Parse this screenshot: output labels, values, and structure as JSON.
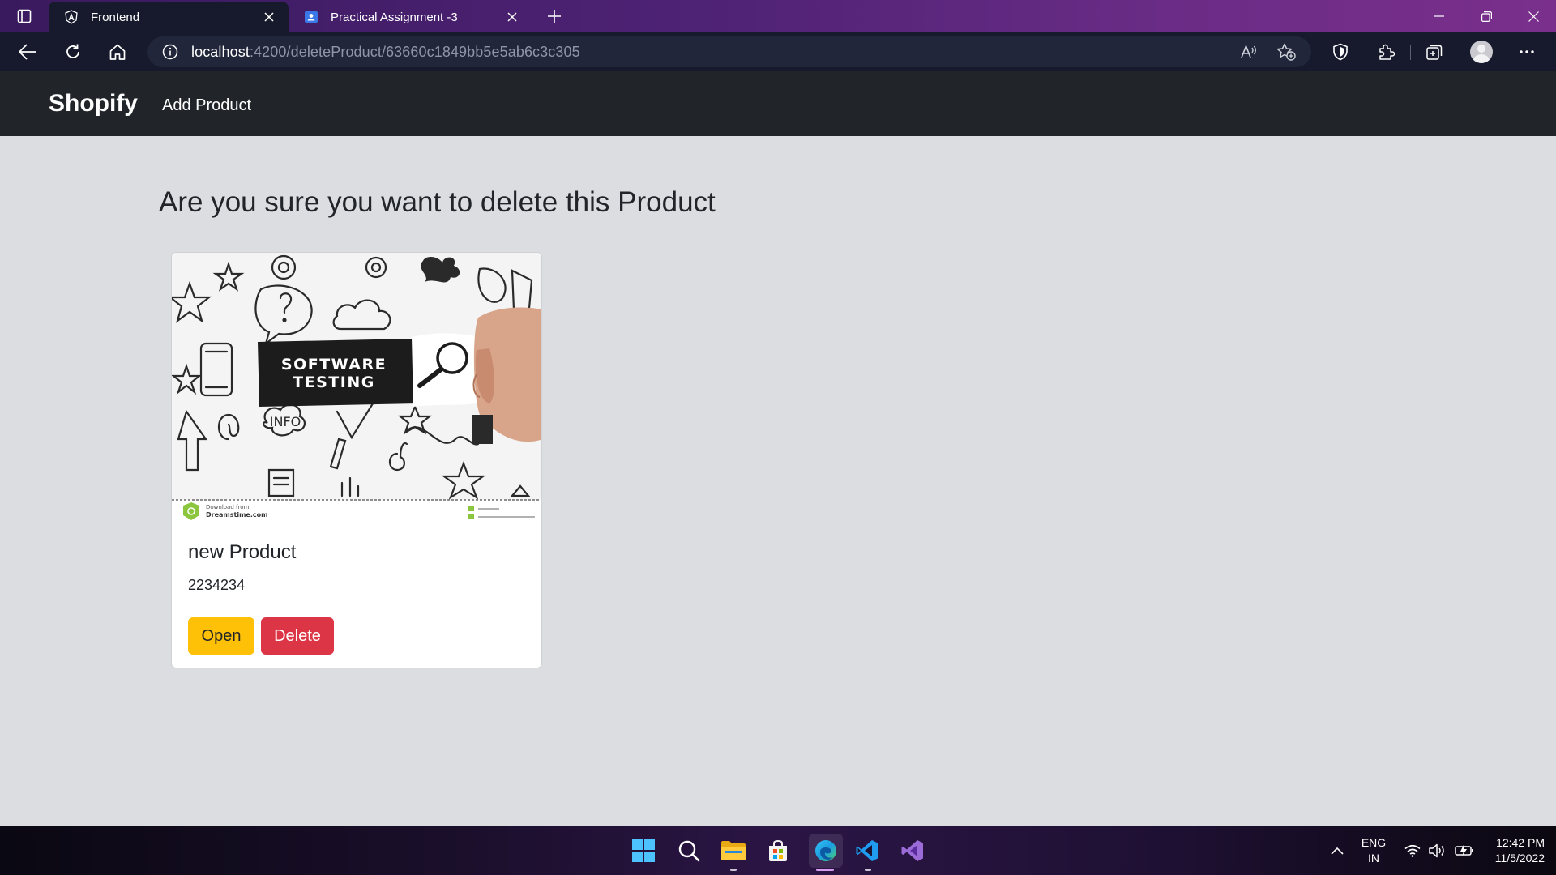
{
  "browser": {
    "tabs": [
      {
        "title": "Frontend",
        "favicon": "angular-icon",
        "active": true
      },
      {
        "title": "Practical Assignment -3",
        "favicon": "classroom-icon",
        "active": false
      }
    ],
    "address": {
      "host": "localhost",
      "path": ":4200/deleteProduct/63660c1849bb5e5ab6c3c305"
    }
  },
  "navbar": {
    "brand": "Shopify",
    "links": [
      "Add Product"
    ]
  },
  "page": {
    "heading": "Are you sure you want to delete this Product"
  },
  "product": {
    "name": "new Product",
    "price": "2234234",
    "image": {
      "caption_line1": "SOFTWARE",
      "caption_line2": "TESTING",
      "info_label": "INFO",
      "source_line1": "Download from",
      "source_line2": "Dreamstime.com"
    },
    "actions": {
      "open": "Open",
      "delete": "Delete"
    }
  },
  "taskbar": {
    "language": "ENG",
    "region": "IN",
    "time": "12:42 PM",
    "date": "11/5/2022"
  },
  "colors": {
    "navbar_bg": "#212529",
    "page_bg": "#dcdde0",
    "open_button": "#ffc107",
    "delete_button": "#dc3545"
  }
}
